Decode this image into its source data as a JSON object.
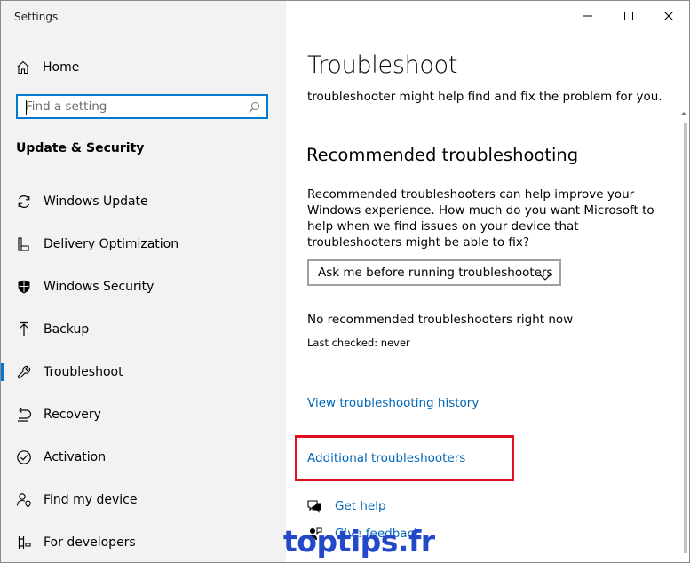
{
  "window": {
    "app_title": "Settings",
    "controls": {
      "minimize": "minimize-icon",
      "maximize": "maximize-icon",
      "close": "close-icon"
    }
  },
  "sidebar": {
    "home_label": "Home",
    "search_placeholder": "Find a setting",
    "section_title": "Update & Security",
    "items": [
      {
        "label": "Windows Update",
        "icon": "sync-icon"
      },
      {
        "label": "Delivery Optimization",
        "icon": "delivery-optimization-icon"
      },
      {
        "label": "Windows Security",
        "icon": "shield-icon"
      },
      {
        "label": "Backup",
        "icon": "upload-arrow-icon"
      },
      {
        "label": "Troubleshoot",
        "icon": "wrench-icon",
        "selected": true
      },
      {
        "label": "Recovery",
        "icon": "recovery-icon"
      },
      {
        "label": "Activation",
        "icon": "check-circle-icon"
      },
      {
        "label": "Find my device",
        "icon": "person-location-icon"
      },
      {
        "label": "For developers",
        "icon": "developer-tools-icon"
      }
    ]
  },
  "main": {
    "title": "Troubleshoot",
    "intro_line": "troubleshooter might help find and fix the problem for you.",
    "recommended_heading": "Recommended troubleshooting",
    "recommended_desc": "Recommended troubleshooters can help improve your Windows experience. How much do you want Microsoft to help when we find issues on your device that troubleshooters might be able to fix?",
    "dropdown_value": "Ask me before running troubleshooters",
    "no_recommended": "No recommended troubleshooters right now",
    "last_checked": "Last checked: never",
    "history_link": "View troubleshooting history",
    "additional_link": "Additional troubleshooters",
    "get_help": "Get help",
    "give_feedback": "Give feedback"
  },
  "overlay": {
    "watermark": "toptips.fr",
    "highlight_color": "#e0101e"
  },
  "colors": {
    "accent": "#0078d4",
    "link": "#0067b8",
    "sidebar_bg": "#f2f2f2"
  }
}
